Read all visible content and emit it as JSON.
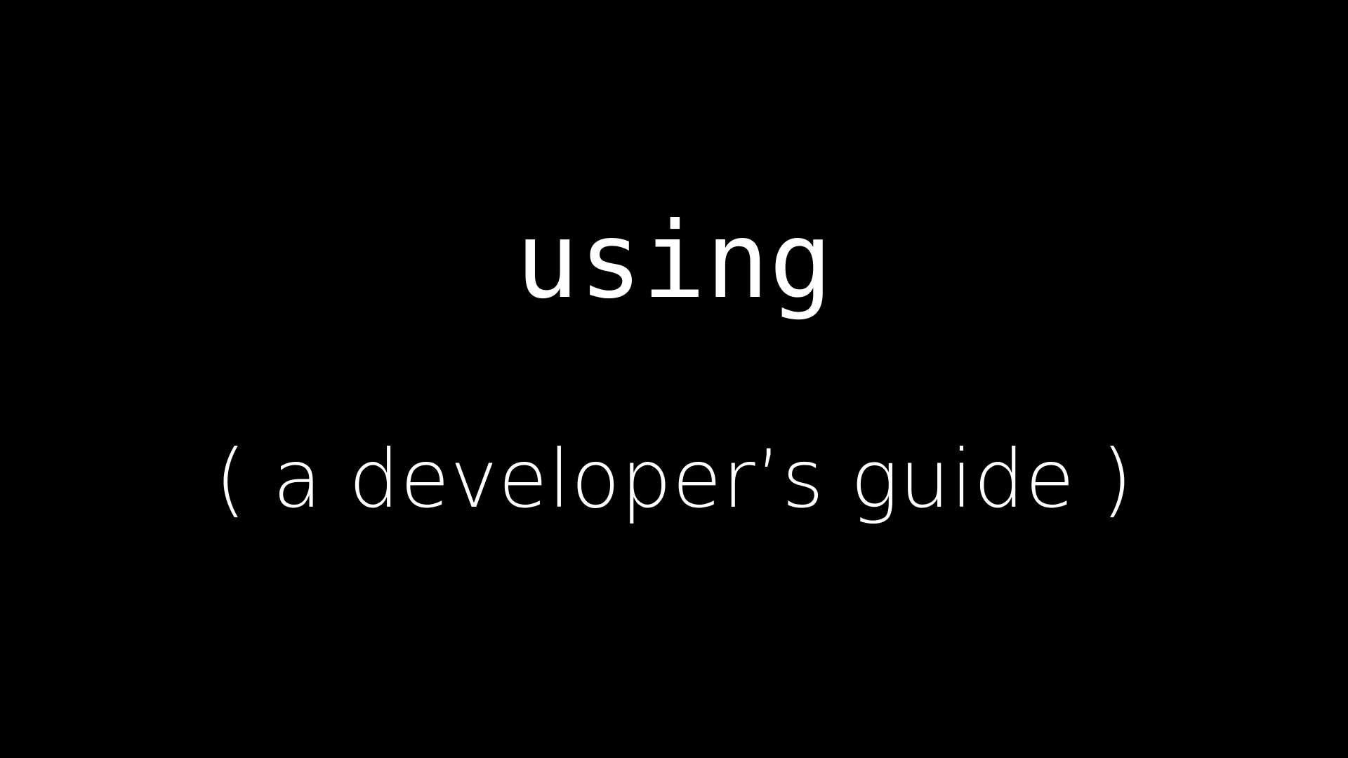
{
  "slide": {
    "title": "using",
    "subtitle": "( a developer’s guide )",
    "colors": {
      "background": "#000000",
      "text": "#ffffff"
    }
  }
}
